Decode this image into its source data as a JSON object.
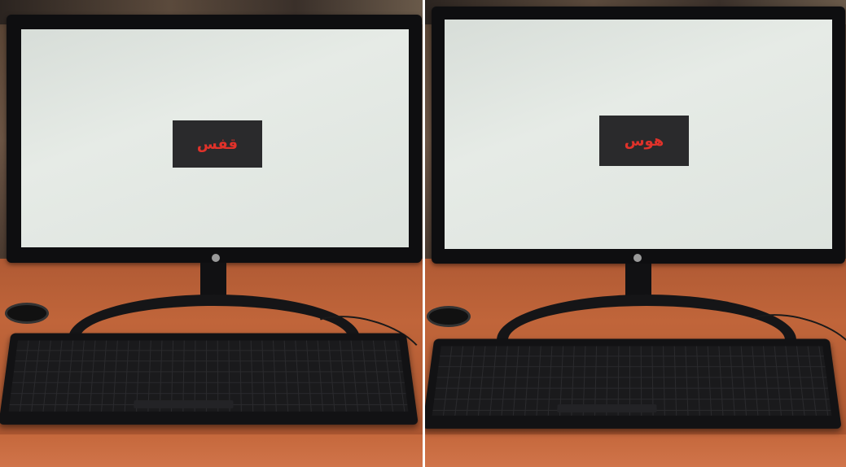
{
  "photos": [
    {
      "side": "left",
      "screen_word": "قفس"
    },
    {
      "side": "right",
      "screen_word": "هوس"
    }
  ],
  "colors": {
    "screen": "#e2e7e2",
    "word_box": "#2a2a2c",
    "word_text": "#e0322a",
    "desk": "#b85a33",
    "monitor_bezel": "#0e0e10"
  }
}
